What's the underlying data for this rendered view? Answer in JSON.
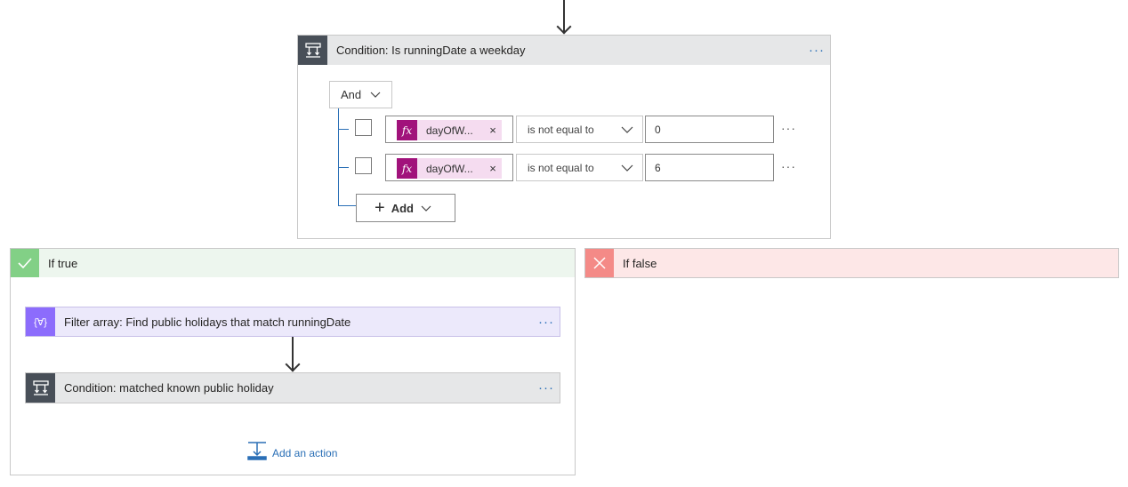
{
  "condition": {
    "title": "Condition: Is runningDate a weekday",
    "more": "···",
    "group_operator": "And",
    "rows": [
      {
        "token_icon": "fx",
        "token": "dayOfW...",
        "token_remove": "×",
        "operator": "is not equal to",
        "value": "0",
        "more": "···"
      },
      {
        "token_icon": "fx",
        "token": "dayOfW...",
        "token_remove": "×",
        "operator": "is not equal to",
        "value": "6",
        "more": "···"
      }
    ],
    "add_label": "Add"
  },
  "if_true": {
    "title": "If true",
    "color": "#82d086",
    "filter_action": {
      "title": "Filter array: Find public holidays that match runningDate",
      "icon_text": "{∀}",
      "more": "···",
      "color": "#8c6cfc"
    },
    "condition_action": {
      "title": "Condition: matched known public holiday",
      "more": "···"
    },
    "add_action_label": "Add an action"
  },
  "if_false": {
    "title": "If false",
    "color": "#f48a87"
  }
}
